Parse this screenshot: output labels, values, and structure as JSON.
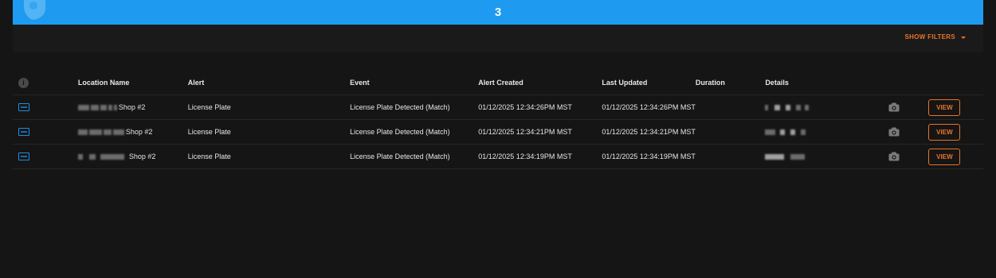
{
  "banner": {
    "count": "3",
    "color": "#1e9bf0"
  },
  "filters": {
    "show_filters_label": "SHOW FILTERS",
    "accent_color": "#e8742a"
  },
  "table": {
    "columns": [
      "Location Name",
      "Alert",
      "Event",
      "Alert Created",
      "Last Updated",
      "Duration",
      "Details"
    ],
    "rows": [
      {
        "location_suffix": "Shop #2",
        "alert": "License Plate",
        "event": "License Plate Detected (Match)",
        "alert_created": "01/12/2025 12:34:26PM MST",
        "last_updated": "01/12/2025 12:34:26PM MST",
        "duration": "",
        "view_label": "VIEW"
      },
      {
        "location_suffix": "Shop #2",
        "alert": "License Plate",
        "event": "License Plate Detected (Match)",
        "alert_created": "01/12/2025 12:34:21PM MST",
        "last_updated": "01/12/2025 12:34:21PM MST",
        "duration": "",
        "view_label": "VIEW"
      },
      {
        "location_suffix": "Shop #2",
        "alert": "License Plate",
        "event": "License Plate Detected (Match)",
        "alert_created": "01/12/2025 12:34:19PM MST",
        "last_updated": "01/12/2025 12:34:19PM MST",
        "duration": "",
        "view_label": "VIEW"
      }
    ]
  },
  "icons": {
    "info": "info-icon",
    "plate": "license-plate-icon",
    "camera": "camera-icon",
    "caret": "chevron-down-icon"
  }
}
